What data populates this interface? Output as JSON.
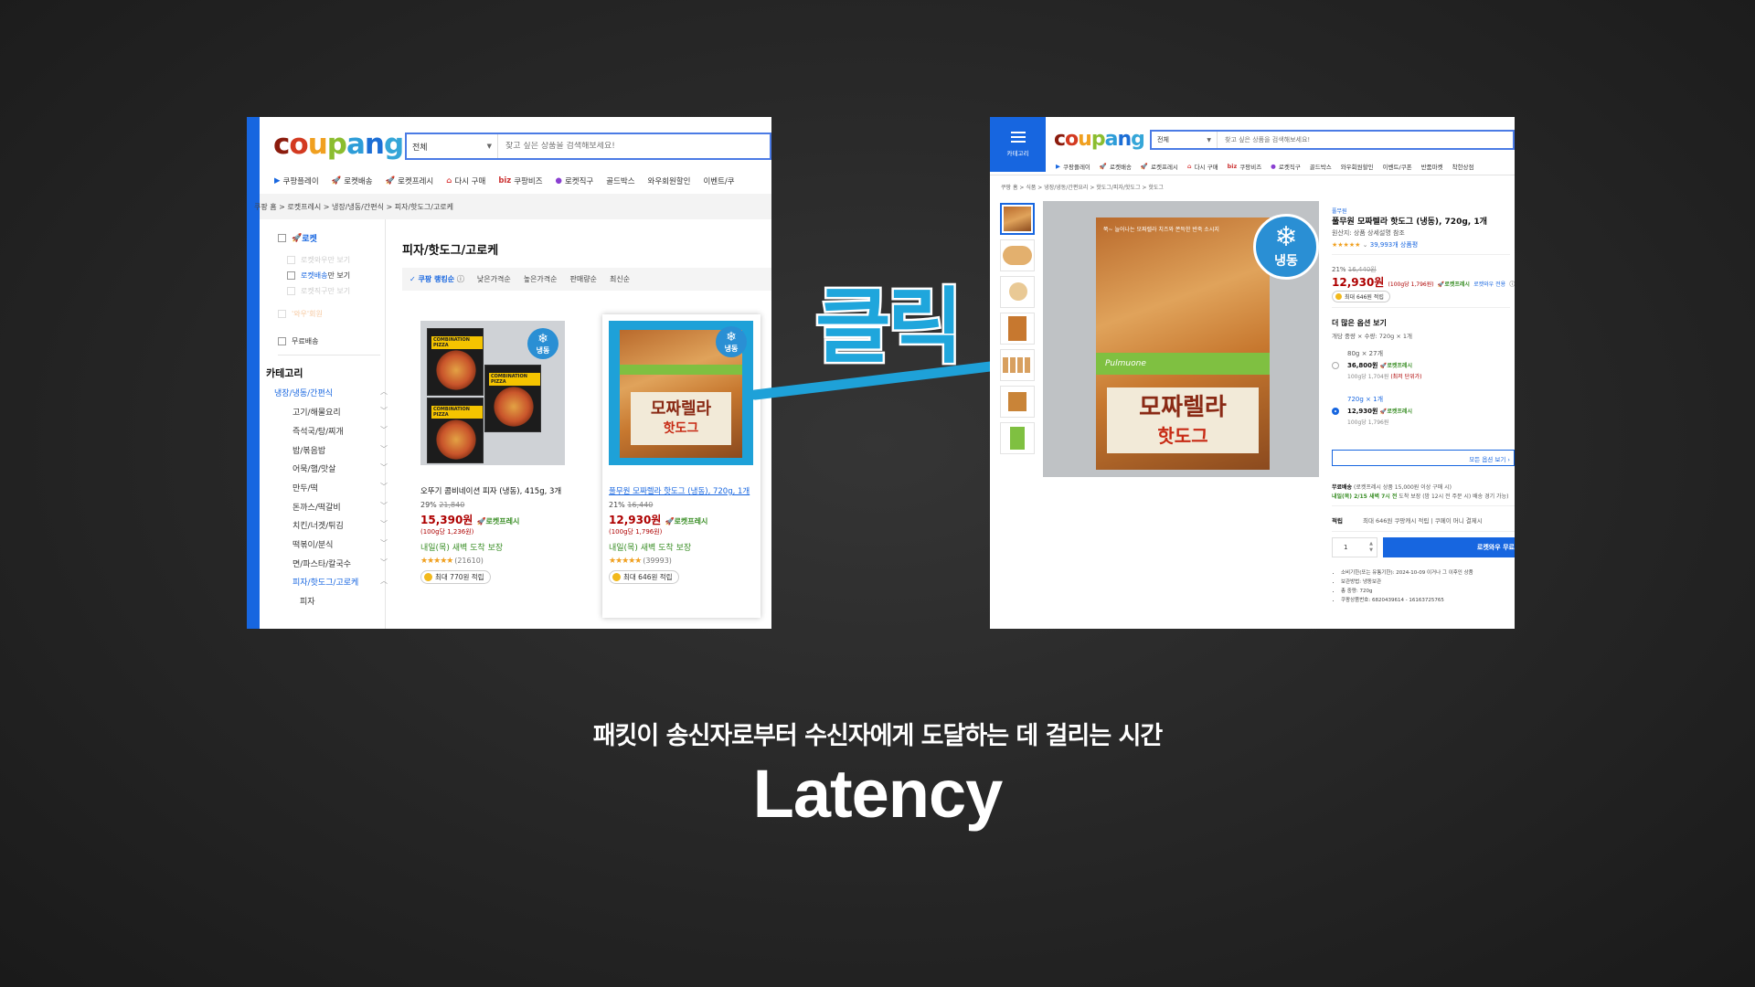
{
  "colors": {
    "coupang_blue": "#1766e0",
    "price_red": "#ae0000",
    "rocket_green": "#3a8e26",
    "arrow_blue": "#1ea1d8",
    "star_orange": "#f0a020"
  },
  "left": {
    "search": {
      "category": "전체",
      "placeholder": "찾고 싶은 상품을 검색해보세요!"
    },
    "nav": [
      "쿠팡플레이",
      "로켓배송",
      "로켓프레시",
      "다시 구매",
      "쿠팡비즈",
      "로켓직구",
      "골드박스",
      "와우회원할인",
      "이벤트/쿠"
    ],
    "breadcrumb": [
      "쿠팡 홈",
      "로켓프레시",
      "냉장/냉동/간편식",
      "피자/핫도그/고로케"
    ],
    "filters": {
      "rocket": "로켓",
      "rocket_wow_only": "로켓와우만 보기",
      "rocket_delivery_only_bold": "로켓배송",
      "rocket_delivery_only_rest": "만 보기",
      "rocket_direct_only": "로켓직구만 보기",
      "fresh_wow": "'와우'회원",
      "free_shipping": "무료배송"
    },
    "category_heading": "카테고리",
    "categories": [
      "냉장/냉동/간편식",
      "고기/해물요리",
      "즉석국/탕/찌개",
      "밥/볶음밥",
      "어묵/햄/맛살",
      "만두/떡",
      "돈까스/떡갈비",
      "치킨/너겟/튀김",
      "떡볶이/분식",
      "면/파스타/칼국수",
      "피자/핫도그/고로케",
      "피자"
    ],
    "page_title": "피자/핫도그/고로케",
    "sort": [
      "쿠팡 랭킹순",
      "낮은가격순",
      "높은가격순",
      "판매량순",
      "최신순"
    ],
    "products": [
      {
        "title": "오뚜기 콤비네이션 피자 (냉동), 415g, 3개",
        "discount": "29%",
        "original": "21,840",
        "price": "15,390원",
        "delivery_badge": "로켓프레시",
        "unit": "(100g당 1,236원)",
        "arrival": "내일(목) 새벽 도착 보장",
        "reviews": "(21610)",
        "reward": "최대 770원 적립",
        "pizza_label": "COMBINATION PIZZA"
      },
      {
        "title": "풀무원 모짜렐라 핫도그 (냉동), 720g, 1개",
        "discount": "21%",
        "original": "16,440",
        "price": "12,930원",
        "delivery_badge": "로켓프레시",
        "unit": "(100g당 1,796원)",
        "arrival": "내일(목) 새벽 도착 보장",
        "reviews": "(39993)",
        "reward": "최대 646원 적립"
      }
    ],
    "frozen_badge": "냉동"
  },
  "click_label": "클릭",
  "subtitle": "패킷이 송신자로부터 수신자에게 도달하는 데 걸리는 시간",
  "title": "Latency",
  "right": {
    "menu_label": "카테고리",
    "search": {
      "category": "전체",
      "placeholder": "찾고 싶은 상품을 검색해보세요!"
    },
    "nav": [
      "쿠팡플레이",
      "로켓배송",
      "로켓프레시",
      "다시 구매",
      "쿠팡비즈",
      "로켓직구",
      "골드박스",
      "와우회원할인",
      "이벤트/쿠폰",
      "반품마켓",
      "착한상점"
    ],
    "breadcrumb": [
      "쿠팡 홈",
      "식품",
      "냉장/냉동/간편요리",
      "핫도그/피자/핫도그",
      "핫도그"
    ],
    "brand": "풀무원",
    "product_title": "풀무원 모짜렐라 핫도그 (냉동), 720g, 1개",
    "origin": "원산지: 상품 상세설명 참조",
    "reviews": "39,993개 상품평",
    "discount": "21%",
    "original": "16,440원",
    "price": "12,930원",
    "unit": "(100g당 1,796원)",
    "delivery_badge": "로켓프레시",
    "wow_note": "로켓와우 전용",
    "reward": "최대 646원 적립",
    "options_heading": "더 많은 옵션 보기",
    "options_sub": "개당 중량 × 수량: 720g × 1개",
    "options": [
      {
        "name": "80g × 27개",
        "price": "36,800원",
        "unit": "100g당 1,704원",
        "note": "(최저 단위가)",
        "selected": false
      },
      {
        "name": "720g × 1개",
        "price": "12,930원",
        "unit": "100g당 1,796원",
        "note": "",
        "selected": true
      }
    ],
    "all_options": "모든 옵션 보기",
    "shipping_title": "무료배송",
    "shipping_note": "(로켓프레시 상품 15,000원 이상 구매 시)",
    "arrival": "내일(목) 2/15 새벽 7시 전",
    "arrival_note": "도착 보장 (밤 12시 전 주문 시) 배송 경기 가능)",
    "points_label": "적립",
    "points_text": "최대 646원 쿠팡캐시 적립",
    "points_extra": "쿠페이 머니 결제시",
    "qty": "1",
    "buy_button": "로켓와우 무료",
    "details": [
      "소비기한(또는 유통기한): 2024-10-09 이거나 그 이후인 상품",
      "보관방법: 냉동보관",
      "총 중량: 720g",
      "쿠팡상품번호: 6820439614 - 16163725765"
    ],
    "frozen_badge": "냉동",
    "bag_brand": "Pulmuone",
    "bag_name": "모짜렐라",
    "bag_name2": "핫도그",
    "bag_tagline": "쭉~ 늘어나는 모짜렐라 치즈와 쫀득한 반죽 소시지"
  }
}
